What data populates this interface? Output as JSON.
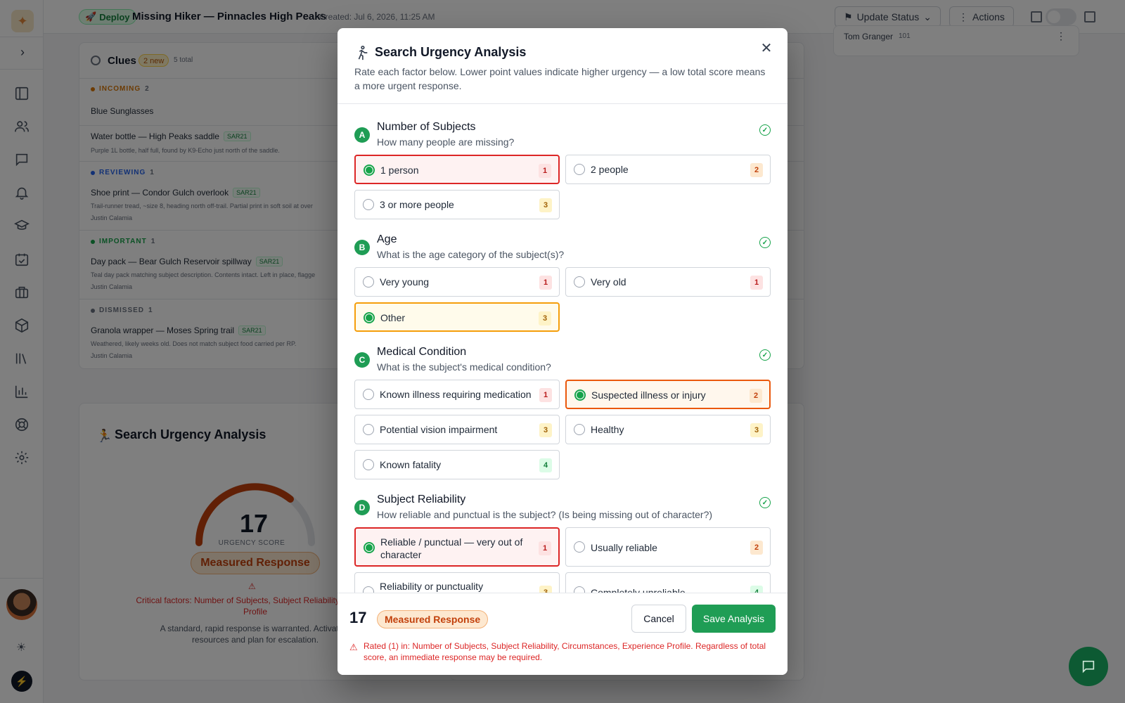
{
  "header": {
    "deploy_label": "Deploy",
    "incident_title": "Missing Hiker — Pinnacles High Peaks",
    "created": "Created: Jul 6, 2026, 11:25 AM",
    "update_status": "Update Status",
    "actions": "Actions"
  },
  "team": {
    "member": "Tom Granger",
    "unit": "101"
  },
  "clues": {
    "title": "Clues",
    "new_badge": "2 new",
    "total": "5 total",
    "groups": [
      {
        "label": "INCOMING",
        "count": "2",
        "color": "#d97706"
      },
      {
        "label": "REVIEWING",
        "count": "1",
        "color": "#2563eb"
      },
      {
        "label": "IMPORTANT",
        "count": "1",
        "color": "#16a34a"
      },
      {
        "label": "DISMISSED",
        "count": "1",
        "color": "#6b7280"
      }
    ],
    "items": [
      {
        "title": "Blue Sunglasses"
      },
      {
        "title": "Water bottle — High Peaks saddle",
        "tag": "SAR21",
        "desc": "Purple 1L bottle, half full, found by K9-Echo just north of the saddle."
      },
      {
        "title": "Shoe print — Condor Gulch overlook",
        "tag": "SAR21",
        "desc": "Trail-runner tread, ~size 8, heading north off-trail. Partial print in soft soil at over",
        "by": "Justin Calamia"
      },
      {
        "title": "Day pack — Bear Gulch Reservoir spillway",
        "tag": "SAR21",
        "desc": "Teal day pack matching subject description. Contents intact. Left in place, flagge",
        "by": "Justin Calamia"
      },
      {
        "title": "Granola wrapper — Moses Spring trail",
        "tag": "SAR21",
        "desc": "Weathered, likely weeks old. Does not match subject food carried per RP.",
        "by": "Justin Calamia"
      }
    ]
  },
  "bg_analysis": {
    "title": "Search Urgency Analysis",
    "score": "17",
    "score_label": "URGENCY SCORE",
    "response": "Measured Response",
    "critical": "Critical factors: Number of Subjects, Subject Reliability, Circums",
    "critical_2": "Profile",
    "desc": "A standard, rapid response is warranted. Activate p",
    "desc_2": "resources and plan for escalation."
  },
  "modal": {
    "title": "Search Urgency Analysis",
    "subtitle": "Rate each factor below. Lower point values indicate higher urgency — a low total score means a more urgent response.",
    "sections": [
      {
        "letter": "A",
        "title": "Number of Subjects",
        "question": "How many people are missing?",
        "options": [
          {
            "label": "1 person",
            "points": "1",
            "selected": true
          },
          {
            "label": "2 people",
            "points": "2"
          },
          {
            "label": "3 or more people",
            "points": "3"
          }
        ]
      },
      {
        "letter": "B",
        "title": "Age",
        "question": "What is the age category of the subject(s)?",
        "options": [
          {
            "label": "Very young",
            "points": "1"
          },
          {
            "label": "Very old",
            "points": "1"
          },
          {
            "label": "Other",
            "points": "3",
            "selected": true
          }
        ]
      },
      {
        "letter": "C",
        "title": "Medical Condition",
        "question": "What is the subject's medical condition?",
        "options": [
          {
            "label": "Known illness requiring medication",
            "points": "1"
          },
          {
            "label": "Suspected illness or injury",
            "points": "2",
            "selected": true
          },
          {
            "label": "Potential vision impairment",
            "points": "3"
          },
          {
            "label": "Healthy",
            "points": "3"
          },
          {
            "label": "Known fatality",
            "points": "4"
          }
        ]
      },
      {
        "letter": "D",
        "title": "Subject Reliability",
        "question": "How reliable and punctual is the subject? (Is being missing out of character?)",
        "options": [
          {
            "label": "Reliable / punctual — very out of character",
            "points": "1",
            "selected": true
          },
          {
            "label": "Usually reliable",
            "points": "2"
          },
          {
            "label": "Reliability or punctuality",
            "points": "3"
          },
          {
            "label": "Completely unreliable",
            "points": "4"
          }
        ]
      }
    ],
    "footer": {
      "score": "17",
      "response": "Measured Response",
      "cancel": "Cancel",
      "save": "Save Analysis",
      "warning": "Rated (1) in: Number of Subjects, Subject Reliability, Circumstances, Experience Profile. Regardless of total score, an immediate response may be required."
    }
  }
}
